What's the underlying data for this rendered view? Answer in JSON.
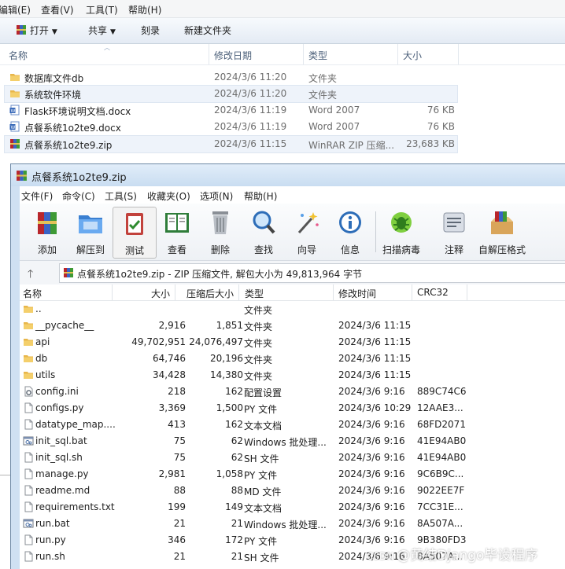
{
  "explorer": {
    "menu": [
      "编辑(E)",
      "查看(V)",
      "工具(T)",
      "帮助(H)"
    ],
    "toolbar": {
      "open": "打开",
      "share": "共享",
      "burn": "刻录",
      "new_folder": "新建文件夹"
    },
    "columns": {
      "name": "名称",
      "date": "修改日期",
      "type": "类型",
      "size": "大小"
    },
    "rows": [
      {
        "icon": "folder-icon",
        "name": "数据库文件db",
        "date": "2024/3/6 11:20",
        "type": "文件夹",
        "size": ""
      },
      {
        "icon": "folder-icon",
        "name": "系统软件环境",
        "date": "2024/3/6 11:20",
        "type": "文件夹",
        "size": ""
      },
      {
        "icon": "word-doc-icon",
        "name": "Flask环境说明文档.docx",
        "date": "2024/3/6 11:19",
        "type": "Word 2007",
        "size": "76 KB"
      },
      {
        "icon": "word-doc-icon",
        "name": "点餐系统1o2te9.docx",
        "date": "2024/3/6 11:19",
        "type": "Word 2007",
        "size": "76 KB"
      },
      {
        "icon": "winrar-archive-icon",
        "name": "点餐系统1o2te9.zip",
        "date": "2024/3/6 11:15",
        "type": "WinRAR ZIP 压缩...",
        "size": "23,683 KB"
      }
    ]
  },
  "winrar": {
    "title": "点餐系统1o2te9.zip",
    "menu": [
      "文件(F)",
      "命令(C)",
      "工具(S)",
      "收藏夹(O)",
      "选项(N)",
      "帮助(H)"
    ],
    "tools": [
      "添加",
      "解压到",
      "测试",
      "查看",
      "删除",
      "查找",
      "向导",
      "信息",
      "扫描病毒",
      "注释",
      "自解压格式"
    ],
    "address": "点餐系统1o2te9.zip - ZIP 压缩文件, 解包大小为 49,813,964 字节",
    "columns": {
      "name": "名称",
      "size": "大小",
      "packed": "压缩后大小",
      "type": "类型",
      "date": "修改时间",
      "crc": "CRC32"
    },
    "rows": [
      {
        "icon": "folder-icon",
        "name": "..",
        "size": "",
        "packed": "",
        "type": "文件夹",
        "date": "",
        "crc": ""
      },
      {
        "icon": "folder-icon",
        "name": "__pycache__",
        "size": "2,916",
        "packed": "1,851",
        "type": "文件夹",
        "date": "2024/3/6 11:15",
        "crc": ""
      },
      {
        "icon": "folder-icon",
        "name": "api",
        "size": "49,702,951",
        "packed": "24,076,497",
        "type": "文件夹",
        "date": "2024/3/6 11:15",
        "crc": ""
      },
      {
        "icon": "folder-icon",
        "name": "db",
        "size": "64,746",
        "packed": "20,196",
        "type": "文件夹",
        "date": "2024/3/6 11:15",
        "crc": ""
      },
      {
        "icon": "folder-icon",
        "name": "utils",
        "size": "34,428",
        "packed": "14,380",
        "type": "文件夹",
        "date": "2024/3/6 11:15",
        "crc": ""
      },
      {
        "icon": "settings-file-icon",
        "name": "config.ini",
        "size": "218",
        "packed": "162",
        "type": "配置设置",
        "date": "2024/3/6 9:16",
        "crc": "889C74C6"
      },
      {
        "icon": "file-icon",
        "name": "configs.py",
        "size": "3,369",
        "packed": "1,500",
        "type": "PY 文件",
        "date": "2024/3/6 10:29",
        "crc": "12AAE3..."
      },
      {
        "icon": "file-icon",
        "name": "datatype_map....",
        "size": "413",
        "packed": "162",
        "type": "文本文档",
        "date": "2024/3/6 9:16",
        "crc": "68FD2071"
      },
      {
        "icon": "batch-file-icon",
        "name": "init_sql.bat",
        "size": "75",
        "packed": "62",
        "type": "Windows 批处理...",
        "date": "2024/3/6 9:16",
        "crc": "41E94AB0"
      },
      {
        "icon": "file-icon",
        "name": "init_sql.sh",
        "size": "75",
        "packed": "62",
        "type": "SH 文件",
        "date": "2024/3/6 9:16",
        "crc": "41E94AB0"
      },
      {
        "icon": "file-icon",
        "name": "manage.py",
        "size": "2,981",
        "packed": "1,058",
        "type": "PY 文件",
        "date": "2024/3/6 9:16",
        "crc": "9C6B9C..."
      },
      {
        "icon": "file-icon",
        "name": "readme.md",
        "size": "88",
        "packed": "88",
        "type": "MD 文件",
        "date": "2024/3/6 9:16",
        "crc": "9022EE7F"
      },
      {
        "icon": "file-icon",
        "name": "requirements.txt",
        "size": "199",
        "packed": "149",
        "type": "文本文档",
        "date": "2024/3/6 9:16",
        "crc": "7CC31E..."
      },
      {
        "icon": "batch-file-icon",
        "name": "run.bat",
        "size": "21",
        "packed": "21",
        "type": "Windows 批处理...",
        "date": "2024/3/6 9:16",
        "crc": "8A507A..."
      },
      {
        "icon": "file-icon",
        "name": "run.py",
        "size": "346",
        "packed": "172",
        "type": "PY 文件",
        "date": "2024/3/6 9:16",
        "crc": "9B380FD3"
      },
      {
        "icon": "file-icon",
        "name": "run.sh",
        "size": "21",
        "packed": "21",
        "type": "SH 文件",
        "date": "2024/3/6 9:16",
        "crc": "8A507A..."
      }
    ]
  },
  "watermark": {
    "prefix": "CSDN",
    "text": "@黄结Django毕设程序"
  }
}
